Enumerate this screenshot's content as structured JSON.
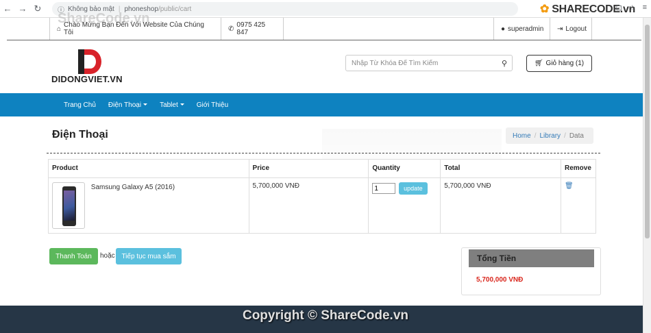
{
  "browser": {
    "security_label": "Không bảo mật",
    "url_host": "phoneshop",
    "url_path": "/public/cart",
    "brand_name": "SHARECODE.vn"
  },
  "watermark": "ShareCode.vn",
  "topbar": {
    "welcome": "Chào Mừng Bạn Đến Với Website Của Chúng Tôi",
    "phone": "0975 425 847",
    "user": "superadmin",
    "logout": "Logout"
  },
  "header": {
    "logo_text": "DIDONGVIET.VN",
    "search_placeholder": "Nhập Từ Khóa Để Tìm Kiếm",
    "cart_label": "Giỏ hàng (1)"
  },
  "nav": {
    "items": [
      {
        "label": "Trang Chủ",
        "dropdown": false
      },
      {
        "label": "Điện Thoại",
        "dropdown": true
      },
      {
        "label": "Tablet",
        "dropdown": true
      },
      {
        "label": "Giới Thiệu",
        "dropdown": false
      }
    ]
  },
  "page": {
    "title": "Điện Thoại",
    "breadcrumb": [
      "Home",
      "Library",
      "Data"
    ]
  },
  "cart": {
    "columns": [
      "Product",
      "Price",
      "Quantity",
      "Total",
      "Remove"
    ],
    "rows": [
      {
        "product": "Samsung Galaxy A5 (2016)",
        "price": "5,700,000 VNĐ",
        "quantity": "1",
        "update_label": "update",
        "total": "5,700,000 VNĐ"
      }
    ]
  },
  "actions": {
    "pay_label": "Thanh Toán",
    "or_text": "hoặc",
    "continue_label": "Tiếp tục mua sắm"
  },
  "summary": {
    "heading": "Tổng Tiền",
    "total": "5,700,000 VNĐ"
  },
  "footer": {
    "copyright": "Copyright © ShareCode.vn"
  },
  "colors": {
    "navbar": "#0e82c0",
    "success": "#5cb85c",
    "info": "#5bc0de",
    "total_red": "#d9261c",
    "footer": "#263646"
  }
}
